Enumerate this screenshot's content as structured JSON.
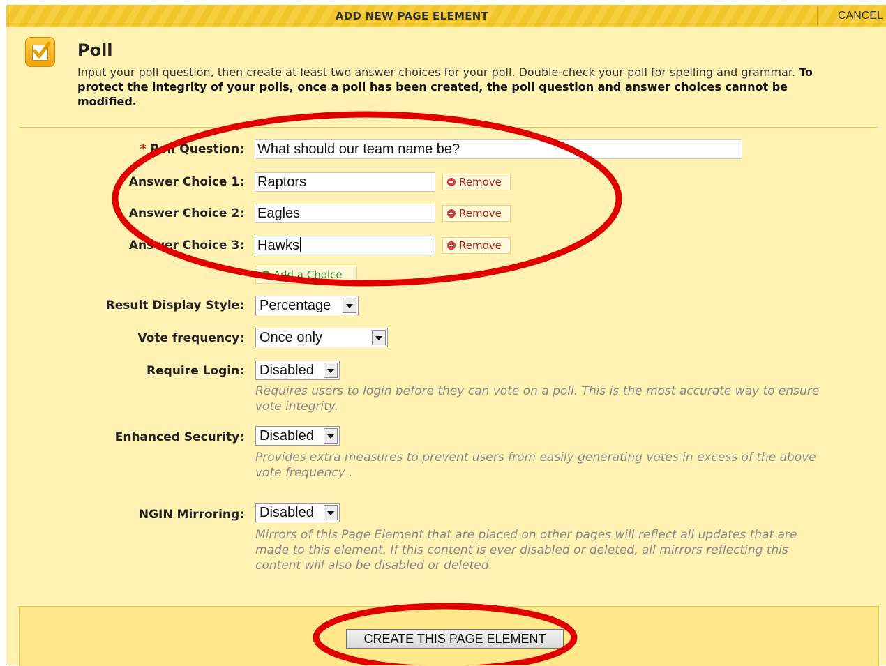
{
  "header": {
    "title": "ADD NEW PAGE ELEMENT",
    "cancel_label": "CANCEL"
  },
  "intro": {
    "title": "Poll",
    "description": "Input your poll question, then create at least two answer choices for your poll. Double-check your poll for spelling and grammar.",
    "warning": "To protect the integrity of your polls, once a poll has been created, the poll question and answer choices cannot be modified."
  },
  "form": {
    "required_marker": "*",
    "poll_question": {
      "label": "Poll Question:",
      "value": "What should our team name be?"
    },
    "answers": [
      {
        "label": "Answer Choice 1:",
        "value": "Raptors",
        "remove_label": "Remove"
      },
      {
        "label": "Answer Choice 2:",
        "value": "Eagles",
        "remove_label": "Remove"
      },
      {
        "label": "Answer Choice 3:",
        "value": "Hawks",
        "remove_label": "Remove"
      }
    ],
    "add_choice_label": "Add a Choice",
    "result_display": {
      "label": "Result Display Style:",
      "value": "Percentage"
    },
    "vote_frequency": {
      "label": "Vote frequency:",
      "value": "Once only"
    },
    "require_login": {
      "label": "Require Login:",
      "value": "Disabled",
      "help": "Requires users to login before they can vote on a poll. This is the most accurate way to ensure vote integrity."
    },
    "enhanced_security": {
      "label": "Enhanced Security:",
      "value": "Disabled",
      "help": "Provides extra measures to prevent users from easily generating votes in excess of the above vote frequency ."
    },
    "ngin_mirroring": {
      "label": "NGIN Mirroring:",
      "value": "Disabled",
      "help": "Mirrors of this Page Element that are placed on other pages will reflect all updates that are made to this element. If this content is ever disabled or deleted, all mirrors reflecting this content will also be disabled or deleted."
    }
  },
  "footer": {
    "create_label": "CREATE THIS PAGE ELEMENT"
  },
  "colors": {
    "panel": "#fff2b3",
    "titlebar": "#f2c52a",
    "footer": "#ffe98a",
    "annotation": "#e00000",
    "required": "#d21f1f"
  },
  "icons": {
    "poll": "poll-checkbox-icon",
    "remove": "remove-icon",
    "add": "add-icon"
  }
}
